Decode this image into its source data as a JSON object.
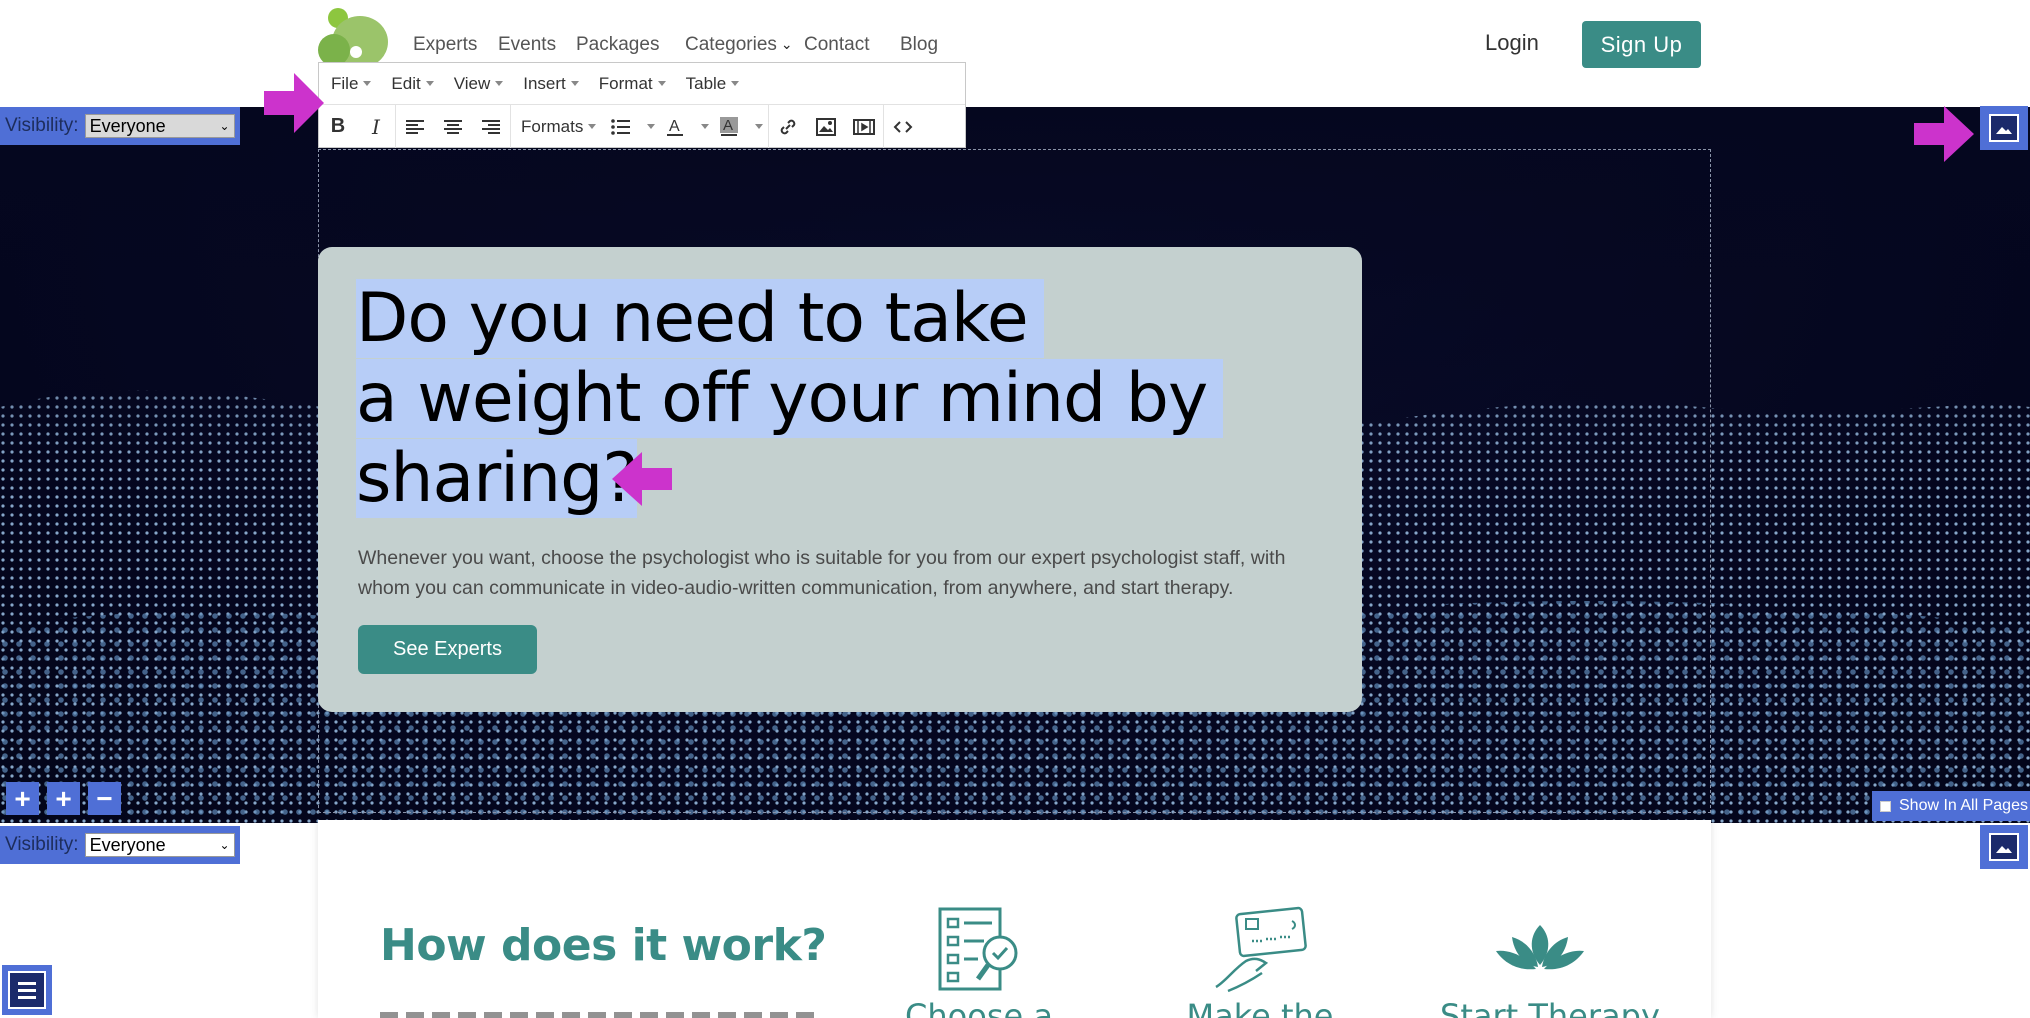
{
  "nav": {
    "links": [
      "Experts",
      "Events",
      "Packages",
      "Categories",
      "Contact",
      "Blog"
    ],
    "login": "Login",
    "signup": "Sign Up"
  },
  "editor": {
    "menus": [
      "File",
      "Edit",
      "View",
      "Insert",
      "Format",
      "Table"
    ],
    "formats_label": "Formats"
  },
  "visibility": {
    "label": "Visibility:",
    "top_value": "Everyone",
    "bottom_value": "Everyone"
  },
  "hero": {
    "headline": [
      "Do you need to take",
      "a weight off your mind by",
      "sharing?"
    ],
    "description": "Whenever you want, choose the psychologist who is suitable for you from our expert psychologist staff, with whom you can communicate in video-audio-written communication, from anywhere, and start therapy.",
    "cta": "See Experts",
    "show_all_pages": "Show In All Pages"
  },
  "controls": {
    "add_label": "+",
    "add_label_2": "+",
    "remove_label": "−"
  },
  "how": {
    "title": "How does it work?",
    "steps": [
      "Choose a",
      "Make the",
      "Start Therapy"
    ]
  },
  "colors": {
    "brand_teal": "#3a8c86",
    "editor_blue": "#4f6fd6",
    "highlight": "#b7cdf7",
    "annotation_arrow": "#cc33cc"
  },
  "icons": {
    "logo": "apple-logo-icon",
    "image": "image-icon",
    "menu": "hamburger-icon"
  }
}
